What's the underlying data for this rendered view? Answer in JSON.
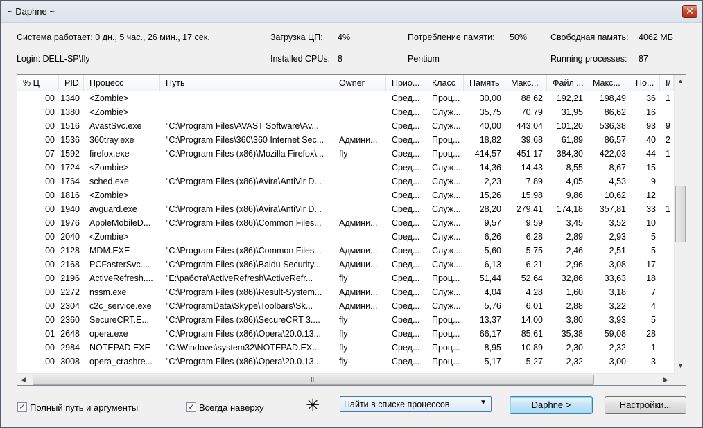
{
  "window": {
    "title": "~ Daphne ~",
    "close": "✕"
  },
  "info": {
    "uptime": "Система работает: 0 дн., 5 час., 26 мин., 17 сек.",
    "cpu_load_label": "Загрузка ЦП:",
    "cpu_load": "4%",
    "mem_usage_label": "Потребление памяти:",
    "mem_usage": "50%",
    "free_mem_label": "Свободная память:",
    "free_mem": "4062 МБ",
    "login": "Login: DELL-SP\\fly",
    "cpus_label": "Installed CPUs:",
    "cpus": "8",
    "cpu_name": "Pentium",
    "procs_label": "Running processes:",
    "procs": "87"
  },
  "columns": [
    "% Ц",
    "PID",
    "Процесс",
    "Путь",
    "Owner",
    "Прио...",
    "Класс",
    "Память",
    "Макс...",
    "Файл ...",
    "Макс...",
    "По...",
    "I/"
  ],
  "rows": [
    [
      "00",
      "1340",
      "<Zombie>",
      "",
      "",
      "Сред...",
      "Проц...",
      "30,00",
      "88,62",
      "192,21",
      "198,49",
      "36",
      "1"
    ],
    [
      "00",
      "1380",
      "<Zombie>",
      "",
      "",
      "Сред...",
      "Служ...",
      "35,75",
      "70,79",
      "31,95",
      "86,62",
      "16",
      ""
    ],
    [
      "00",
      "1516",
      "AvastSvc.exe",
      "\"C:\\Program Files\\AVAST Software\\Av...",
      "",
      "Сред...",
      "Служ...",
      "40,00",
      "443,04",
      "101,20",
      "536,38",
      "93",
      "9"
    ],
    [
      "00",
      "1536",
      "360tray.exe",
      "\"C:\\Program Files\\360\\360 Internet Sec...",
      "Админи...",
      "Сред...",
      "Проц...",
      "18,82",
      "39,68",
      "61,89",
      "86,57",
      "40",
      "2"
    ],
    [
      "07",
      "1592",
      "firefox.exe",
      "\"C:\\Program Files (x86)\\Mozilla Firefox\\...",
      "fly",
      "Сред...",
      "Проц...",
      "414,57",
      "451,17",
      "384,30",
      "422,03",
      "44",
      "1"
    ],
    [
      "00",
      "1724",
      "<Zombie>",
      "",
      "",
      "Сред...",
      "Служ...",
      "14,36",
      "14,43",
      "8,55",
      "8,67",
      "15",
      ""
    ],
    [
      "00",
      "1764",
      "sched.exe",
      "\"C:\\Program Files (x86)\\Avira\\AntiVir D...",
      "",
      "Сред...",
      "Служ...",
      "2,23",
      "7,89",
      "4,05",
      "4,53",
      "9",
      ""
    ],
    [
      "00",
      "1816",
      "<Zombie>",
      "",
      "",
      "Сред...",
      "Служ...",
      "15,26",
      "15,98",
      "9,86",
      "10,62",
      "12",
      ""
    ],
    [
      "00",
      "1940",
      "avguard.exe",
      "\"C:\\Program Files (x86)\\Avira\\AntiVir D...",
      "",
      "Сред...",
      "Служ...",
      "28,20",
      "279,41",
      "174,18",
      "357,81",
      "33",
      "1"
    ],
    [
      "00",
      "1976",
      "AppleMobileD...",
      "\"C:\\Program Files (x86)\\Common Files...",
      "Админи...",
      "Сред...",
      "Служ...",
      "9,57",
      "9,59",
      "3,45",
      "3,52",
      "10",
      ""
    ],
    [
      "00",
      "2040",
      "<Zombie>",
      "",
      "",
      "Сред...",
      "Служ...",
      "6,26",
      "6,28",
      "2,89",
      "2,93",
      "5",
      ""
    ],
    [
      "00",
      "2128",
      "MDM.EXE",
      "\"C:\\Program Files (x86)\\Common Files...",
      "Админи...",
      "Сред...",
      "Служ...",
      "5,60",
      "5,75",
      "2,46",
      "2,51",
      "5",
      ""
    ],
    [
      "00",
      "2168",
      "PCFasterSvc....",
      "\"C:\\Program Files (x86)\\Baidu Security...",
      "Админи...",
      "Сред...",
      "Служ...",
      "6,13",
      "6,21",
      "2,96",
      "3,08",
      "17",
      ""
    ],
    [
      "00",
      "2196",
      "ActiveRefresh....",
      "\"E:\\работа\\ActiveRefresh\\ActiveRefr...",
      "fly",
      "Сред...",
      "Проц...",
      "51,44",
      "52,64",
      "32,86",
      "33,63",
      "18",
      ""
    ],
    [
      "00",
      "2272",
      "nssm.exe",
      "\"C:\\Program Files (x86)\\Result-System...",
      "Админи...",
      "Сред...",
      "Служ...",
      "4,04",
      "4,28",
      "1,60",
      "3,18",
      "7",
      ""
    ],
    [
      "00",
      "2304",
      "c2c_service.exe",
      "\"C:\\ProgramData\\Skype\\Toolbars\\Sk...",
      "Админи...",
      "Сред...",
      "Служ...",
      "5,76",
      "6,01",
      "2,88",
      "3,22",
      "4",
      ""
    ],
    [
      "00",
      "2360",
      "SecureCRT.E...",
      "\"C:\\Program Files (x86)\\SecureCRT 3....",
      "fly",
      "Сред...",
      "Проц...",
      "13,37",
      "14,00",
      "3,80",
      "3,93",
      "5",
      ""
    ],
    [
      "01",
      "2648",
      "opera.exe",
      "\"C:\\Program Files (x86)\\Opera\\20.0.13...",
      "fly",
      "Сред...",
      "Проц...",
      "66,17",
      "85,61",
      "35,38",
      "59,08",
      "28",
      ""
    ],
    [
      "00",
      "2984",
      "NOTEPAD.EXE",
      "\"C:\\Windows\\system32\\NOTEPAD.EX...",
      "fly",
      "Сред...",
      "Проц...",
      "8,95",
      "10,89",
      "2,30",
      "2,32",
      "1",
      ""
    ],
    [
      "00",
      "3008",
      "opera_crashre...",
      "\"C:\\Program Files (x86)\\Opera\\20.0.13...",
      "fly",
      "Сред...",
      "Проц...",
      "5,17",
      "5,27",
      "2,32",
      "3,00",
      "3",
      ""
    ]
  ],
  "scroll": {
    "up": "▲",
    "down": "▼",
    "left": "◀",
    "right": "▶",
    "grip": "III"
  },
  "bottom": {
    "full_path_label": "Полный путь и аргументы",
    "always_on_top_label": "Всегда наверху",
    "check_mark": "✓",
    "finder_glyph": "✳",
    "find_combo": "Найти в списке процессов",
    "combo_arrow": "▼",
    "daphne_button": "Daphne >",
    "settings_button": "Настройки..."
  }
}
